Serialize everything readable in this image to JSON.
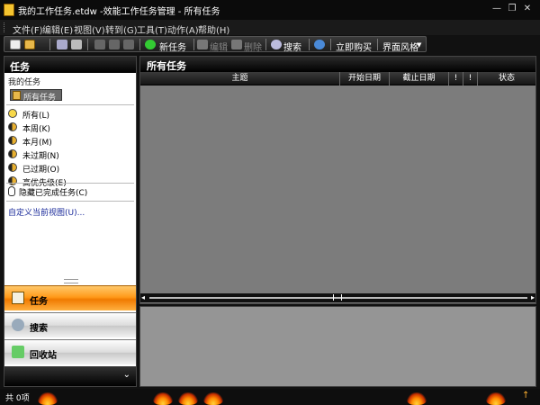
{
  "window": {
    "title": "我的工作任务.etdw -效能工作任务管理 - 所有任务",
    "minimize": "—",
    "restore": "❐",
    "close": "✕"
  },
  "menu": [
    "文件(F)",
    "编辑(E)",
    "视图(V)",
    "转到(G)",
    "工具(T)",
    "动作(A)",
    "帮助(H)"
  ],
  "toolbar": {
    "new_task": "新任务",
    "edit": "编辑",
    "delete": "删除",
    "search": "搜索",
    "buy_now": "立即购买",
    "skin": "界面风格"
  },
  "left_pane": {
    "header": "任务",
    "my_tasks": "我的任务",
    "all_tasks": "所有任务",
    "filters": [
      {
        "label": "所有(L)",
        "icon": "full-moon-icon"
      },
      {
        "label": "本周(K)",
        "icon": "crescent-moon-icon"
      },
      {
        "label": "本月(M)",
        "icon": "crescent-moon-icon"
      },
      {
        "label": "未过期(N)",
        "icon": "crescent-moon-icon"
      },
      {
        "label": "已过期(O)",
        "icon": "crescent-moon-icon"
      },
      {
        "label": "高优先级(E)",
        "icon": "crescent-moon-icon"
      }
    ],
    "hide_completed": "隐藏已完成任务(C)",
    "custom_view": "自定义当前视图(U)..."
  },
  "nav": {
    "tasks": "任务",
    "search": "搜索",
    "recycle": "回收站"
  },
  "grid": {
    "header": "所有任务",
    "columns": [
      "主题",
      "开始日期",
      "截止日期",
      "!",
      "!",
      "状态"
    ]
  },
  "status": {
    "count": "共 0项"
  },
  "colors": {
    "nav_active": "#ff9a1a",
    "grid_bg": "#7c7c7c",
    "link": "#1a2a9a"
  }
}
